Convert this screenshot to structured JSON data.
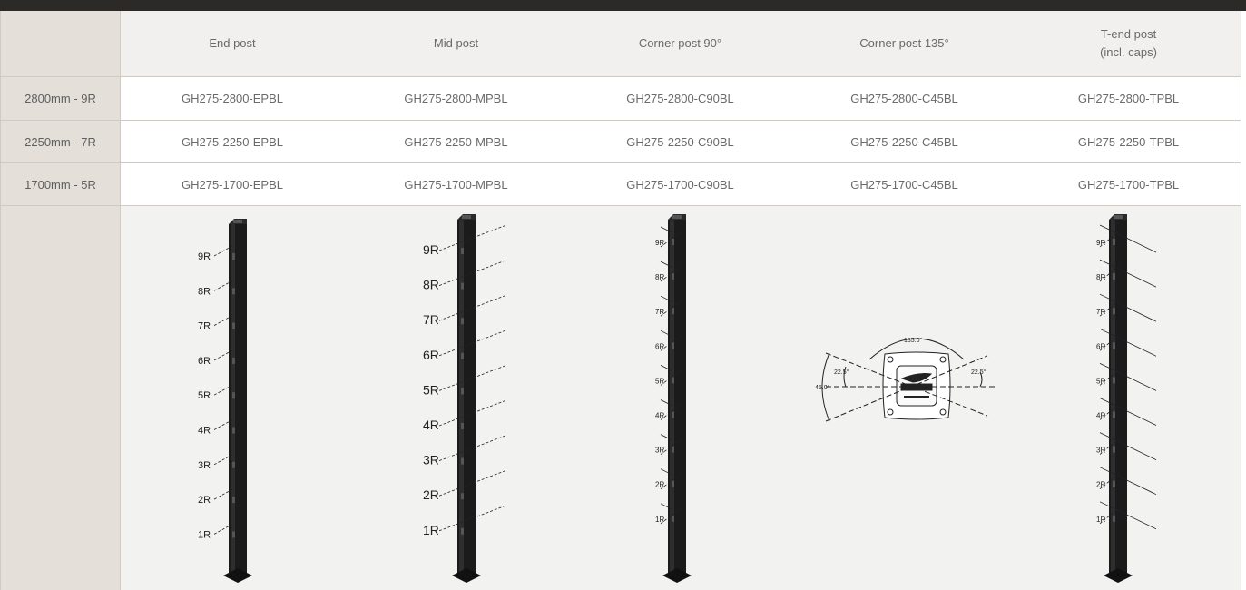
{
  "headers": [
    "End post",
    "Mid post",
    "Corner post 90°",
    "Corner post 135°",
    "T-end post",
    "(incl. caps)"
  ],
  "rows": [
    {
      "label": "2800mm - 9R",
      "codes": [
        "GH275-2800-EPBL",
        "GH275-2800-MPBL",
        "GH275-2800-C90BL",
        "GH275-2800-C45BL",
        "GH275-2800-TPBL"
      ]
    },
    {
      "label": "2250mm - 7R",
      "codes": [
        "GH275-2250-EPBL",
        "GH275-2250-MPBL",
        "GH275-2250-C90BL",
        "GH275-2250-C45BL",
        "GH275-2250-TPBL"
      ]
    },
    {
      "label": "1700mm - 5R",
      "codes": [
        "GH275-1700-EPBL",
        "GH275-1700-MPBL",
        "GH275-1700-C90BL",
        "GH275-1700-C45BL",
        "GH275-1700-TPBL"
      ]
    }
  ],
  "rail_labels": [
    "9R",
    "8R",
    "7R",
    "6R",
    "5R",
    "4R",
    "3R",
    "2R",
    "1R"
  ],
  "angle_labels": {
    "top": "135.0°",
    "left_outer": "45.0°",
    "left_inner": "22.5°",
    "right_inner": "22.5°"
  },
  "colors": {
    "topbar": "#2c2a27",
    "label_bg": "#e4dfd9",
    "header_bg": "#f1f0ee",
    "diagram_bg": "#f2f2f1",
    "post": "#1b1b1b"
  }
}
